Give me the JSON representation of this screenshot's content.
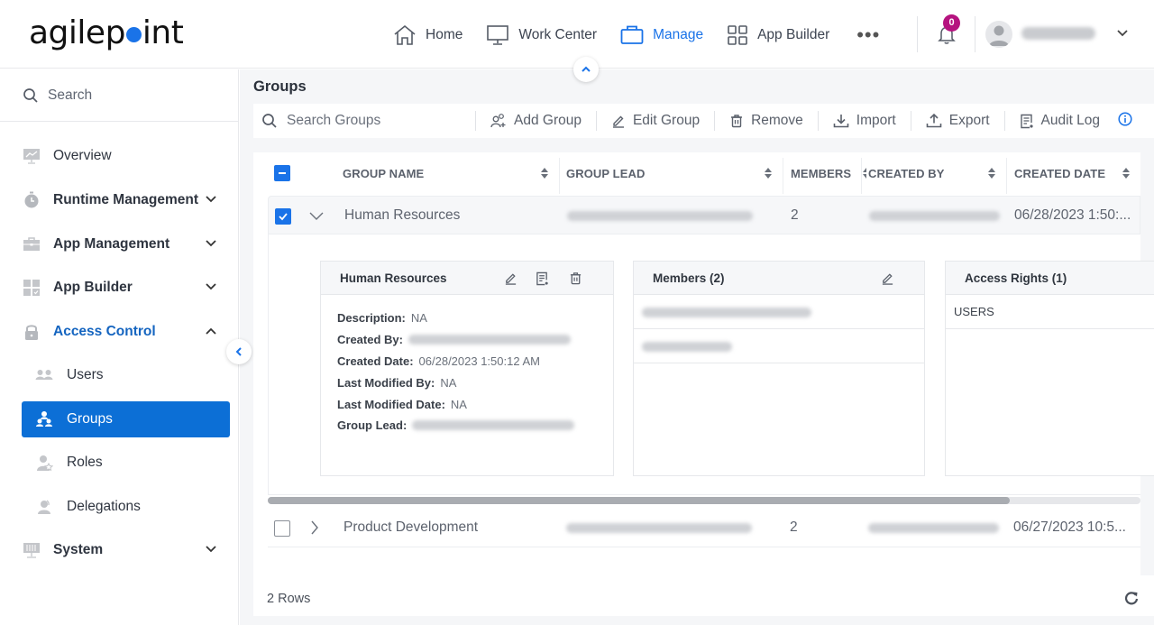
{
  "app": {
    "logo_text_pre": "agilep",
    "logo_text_post": "int"
  },
  "topnav": {
    "items": [
      {
        "label": "Home",
        "icon": "home-icon",
        "active": false
      },
      {
        "label": "Work Center",
        "icon": "monitor-icon",
        "active": false
      },
      {
        "label": "Manage",
        "icon": "briefcase-icon",
        "active": true
      },
      {
        "label": "App Builder",
        "icon": "grid-icon",
        "active": false
      }
    ],
    "more_label": "•••",
    "notification_count": "0",
    "user_name": "[redacted]"
  },
  "sidebar": {
    "search_placeholder": "Search",
    "items": [
      {
        "label": "Overview",
        "icon": "chart-monitor-icon",
        "expandable": false
      },
      {
        "label": "Runtime Management",
        "icon": "stopwatch-icon",
        "expandable": true
      },
      {
        "label": "App Management",
        "icon": "toolbox-icon",
        "expandable": true
      },
      {
        "label": "App Builder",
        "icon": "app-grid-icon",
        "expandable": true
      },
      {
        "label": "Access Control",
        "icon": "lock-icon",
        "expandable": true,
        "expanded": true
      },
      {
        "label": "System",
        "icon": "server-icon",
        "expandable": true
      }
    ],
    "sub_items": [
      {
        "label": "Users",
        "icon": "users-icon"
      },
      {
        "label": "Groups",
        "icon": "groups-icon",
        "selected": true
      },
      {
        "label": "Roles",
        "icon": "roles-icon"
      },
      {
        "label": "Delegations",
        "icon": "delegations-icon"
      }
    ]
  },
  "page": {
    "title": "Groups"
  },
  "toolbar": {
    "search_placeholder": "Search Groups",
    "add_group": "Add Group",
    "edit_group": "Edit Group",
    "remove": "Remove",
    "import": "Import",
    "export": "Export",
    "audit_log": "Audit Log"
  },
  "table": {
    "columns": [
      "GROUP NAME",
      "GROUP LEAD",
      "MEMBERS",
      "CREATED BY",
      "CREATED DATE"
    ],
    "rows": [
      {
        "group_name": "Human Resources",
        "group_lead": "[redacted]",
        "members": "2",
        "created_by": "[redacted]",
        "created_date": "06/28/2023 1:50:...",
        "checked": true,
        "expanded": true
      },
      {
        "group_name": "Product Development",
        "group_lead": "[redacted]",
        "members": "2",
        "created_by": "[redacted]",
        "created_date": "06/27/2023 10:5...",
        "checked": false,
        "expanded": false
      }
    ],
    "row_count_label": "2 Rows",
    "hscroll_position": 0.0,
    "hscroll_visible_fraction": 0.85
  },
  "detail": {
    "info_card": {
      "title": "Human Resources",
      "fields": [
        {
          "label": "Description:",
          "value": "NA",
          "redacted": false
        },
        {
          "label": "Created By:",
          "value": "",
          "redacted": true
        },
        {
          "label": "Created Date:",
          "value": "06/28/2023 1:50:12 AM",
          "redacted": false
        },
        {
          "label": "Last Modified By:",
          "value": "NA",
          "redacted": false
        },
        {
          "label": "Last Modified Date:",
          "value": "NA",
          "redacted": false
        },
        {
          "label": "Group Lead:",
          "value": "",
          "redacted": true
        }
      ]
    },
    "members_card": {
      "title": "Members (2)",
      "members": [
        "[redacted]",
        "[redacted]"
      ]
    },
    "access_card": {
      "title": "Access Rights (1)",
      "rights": [
        "USERS"
      ]
    }
  },
  "colors": {
    "accent": "#1a73e8",
    "selected_nav_bg": "#0c6fd6",
    "badge": "#b5137f"
  }
}
